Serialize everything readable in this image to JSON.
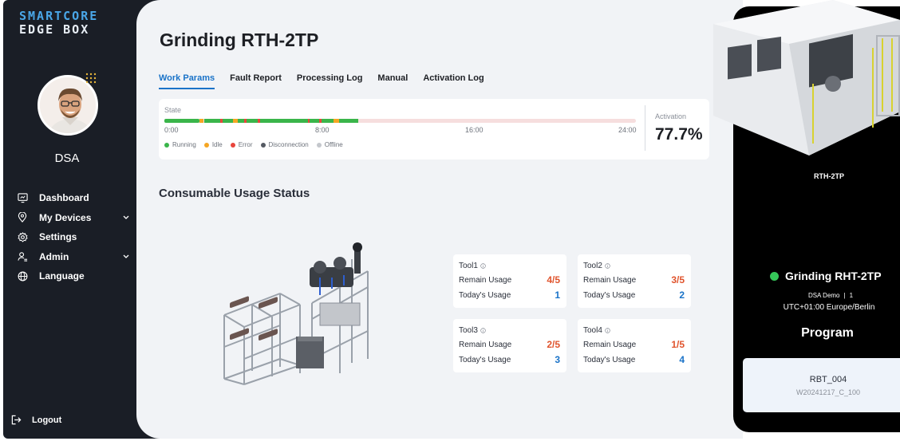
{
  "brand": {
    "line1": "SMARTCORE",
    "line2": "EDGE BOX"
  },
  "user": {
    "name": "DSA"
  },
  "nav": {
    "items": [
      {
        "label": "Dashboard",
        "icon": "dashboard-icon"
      },
      {
        "label": "My Devices",
        "icon": "location-pin-icon",
        "expandable": true
      },
      {
        "label": "Settings",
        "icon": "gear-icon"
      },
      {
        "label": "Admin",
        "icon": "admin-icon",
        "expandable": true
      },
      {
        "label": "Language",
        "icon": "globe-icon"
      }
    ],
    "logout": "Logout"
  },
  "page": {
    "title": "Grinding RTH-2TP"
  },
  "tabs": [
    {
      "label": "Work Params",
      "active": true
    },
    {
      "label": "Fault Report"
    },
    {
      "label": "Processing Log"
    },
    {
      "label": "Manual"
    },
    {
      "label": "Activation Log"
    }
  ],
  "state": {
    "label": "State",
    "ticks": [
      "0:00",
      "8:00",
      "16:00",
      "24:00"
    ],
    "legend": [
      {
        "label": "Running",
        "color": "#3ab54a"
      },
      {
        "label": "Idle",
        "color": "#f5a623"
      },
      {
        "label": "Error",
        "color": "#e8453c"
      },
      {
        "label": "Disconnection",
        "color": "#555a63"
      },
      {
        "label": "Offline",
        "color": "#c4c7cc"
      }
    ],
    "activation_label": "Activation",
    "activation_value": "77.7%"
  },
  "consumables": {
    "title": "Consumable Usage Status",
    "remain_label": "Remain Usage",
    "today_label": "Today's Usage",
    "tools": [
      {
        "name": "Tool1",
        "remain": "4/5",
        "today": "1"
      },
      {
        "name": "Tool2",
        "remain": "3/5",
        "today": "2"
      },
      {
        "name": "Tool3",
        "remain": "2/5",
        "today": "3"
      },
      {
        "name": "Tool4",
        "remain": "1/5",
        "today": "4"
      }
    ]
  },
  "device": {
    "machine_label": "RTH-2TP",
    "title": "Grinding RHT-2TP",
    "status_color": "#35c759",
    "org": "DSA Demo",
    "id": "1",
    "timezone": "UTC+01:00 Europe/Berlin",
    "program_heading": "Program",
    "program_name": "RBT_004",
    "program_code": "W20241217_C_100"
  },
  "colors": {
    "accent": "#1a73c8",
    "remain": "#e0542d",
    "sidebar": "#1a1e26"
  }
}
